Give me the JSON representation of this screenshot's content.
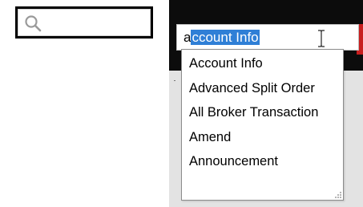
{
  "left_search": {
    "icon": "search-icon",
    "value": "",
    "placeholder": ""
  },
  "combo": {
    "typed_prefix": "a",
    "selected_completion": "ccount Info",
    "cursor_icon": "text-cursor-icon"
  },
  "dropdown": {
    "items": [
      {
        "label": "Account Info"
      },
      {
        "label": "Advanced Split Order"
      },
      {
        "label": "All Broker Transaction"
      },
      {
        "label": "Amend"
      },
      {
        "label": "Announcement"
      }
    ],
    "resize_icon": "resize-grip-icon"
  },
  "colors": {
    "selection": "#2f7fd6",
    "header_bg": "#0c0c0c",
    "accent_red": "#c81f1f"
  }
}
